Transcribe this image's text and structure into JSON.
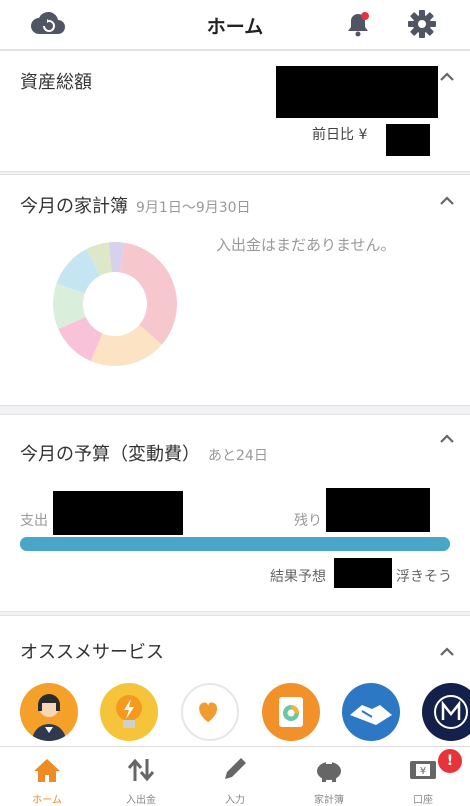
{
  "header": {
    "title": "ホーム",
    "icons": [
      "cloud-sync-icon",
      "bell-icon",
      "gear-icon"
    ],
    "bell_has_badge": true
  },
  "assets": {
    "title": "資産総額",
    "diff_label": "前日比 ¥",
    "amount_redacted": true
  },
  "household": {
    "title": "今月の家計簿",
    "period": "9月1日〜9月30日",
    "empty_message": "入出金はまだありません。",
    "donut_colors": [
      "#f6c7cc",
      "#fbe3c4",
      "#f8c3d8",
      "#d9eedb",
      "#c6e5f2",
      "#dfe7c9",
      "#d8d1ec"
    ]
  },
  "budget": {
    "title": "今月の予算（変動費）",
    "days_left": "あと24日",
    "spent_label": "支出",
    "remaining_label": "残り",
    "forecast_label": "結果予想",
    "forecast_suffix": "浮きそう",
    "progress_fraction": 1.0,
    "bar_color": "#4aa6c8"
  },
  "services": {
    "title": "オススメサービス",
    "items": [
      "person-avatar-icon",
      "lightbulb-icon",
      "heart-icon",
      "chart-card-icon",
      "handshake-icon",
      "m-logo-icon"
    ]
  },
  "tabbar": {
    "tabs": [
      {
        "label": "ホーム",
        "active": true
      },
      {
        "label": "入出金",
        "active": false
      },
      {
        "label": "入力",
        "active": false
      },
      {
        "label": "家計簿",
        "active": false
      },
      {
        "label": "口座",
        "active": false
      }
    ],
    "account_badge": "!",
    "accent": "#f08a24"
  }
}
